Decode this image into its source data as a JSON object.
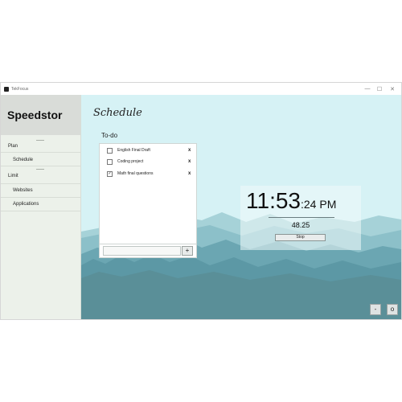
{
  "window": {
    "title": "TekFocus",
    "controls": {
      "minimize": "—",
      "maximize": "☐",
      "close": "✕"
    }
  },
  "sidebar": {
    "brand": "Speedstor",
    "items": [
      {
        "label": "Plan"
      },
      {
        "label": "Schedule"
      },
      {
        "label": "Limit"
      },
      {
        "label": "Websites"
      },
      {
        "label": "Applications"
      }
    ]
  },
  "main": {
    "title": "Schedule",
    "todo": {
      "heading": "To-do",
      "items": [
        {
          "text": "English Final Draft",
          "checked": false
        },
        {
          "text": "Coding project",
          "checked": false
        },
        {
          "text": "Math final questions",
          "checked": true
        }
      ],
      "delete_label": "x",
      "input_value": "",
      "add_label": "+"
    },
    "clock": {
      "time": "11:53",
      "seconds_period": ":24 PM",
      "elapsed": "48.25",
      "stop_label": "Stop"
    },
    "corner_buttons": {
      "minus": "-",
      "circle": "o"
    }
  },
  "colors": {
    "sky": "#d6f2f5",
    "mountain_far": "#9bcbd2",
    "mountain_mid": "#6eaab6",
    "forest": "#5b96a3",
    "sidebar": "#ecf1ea"
  }
}
